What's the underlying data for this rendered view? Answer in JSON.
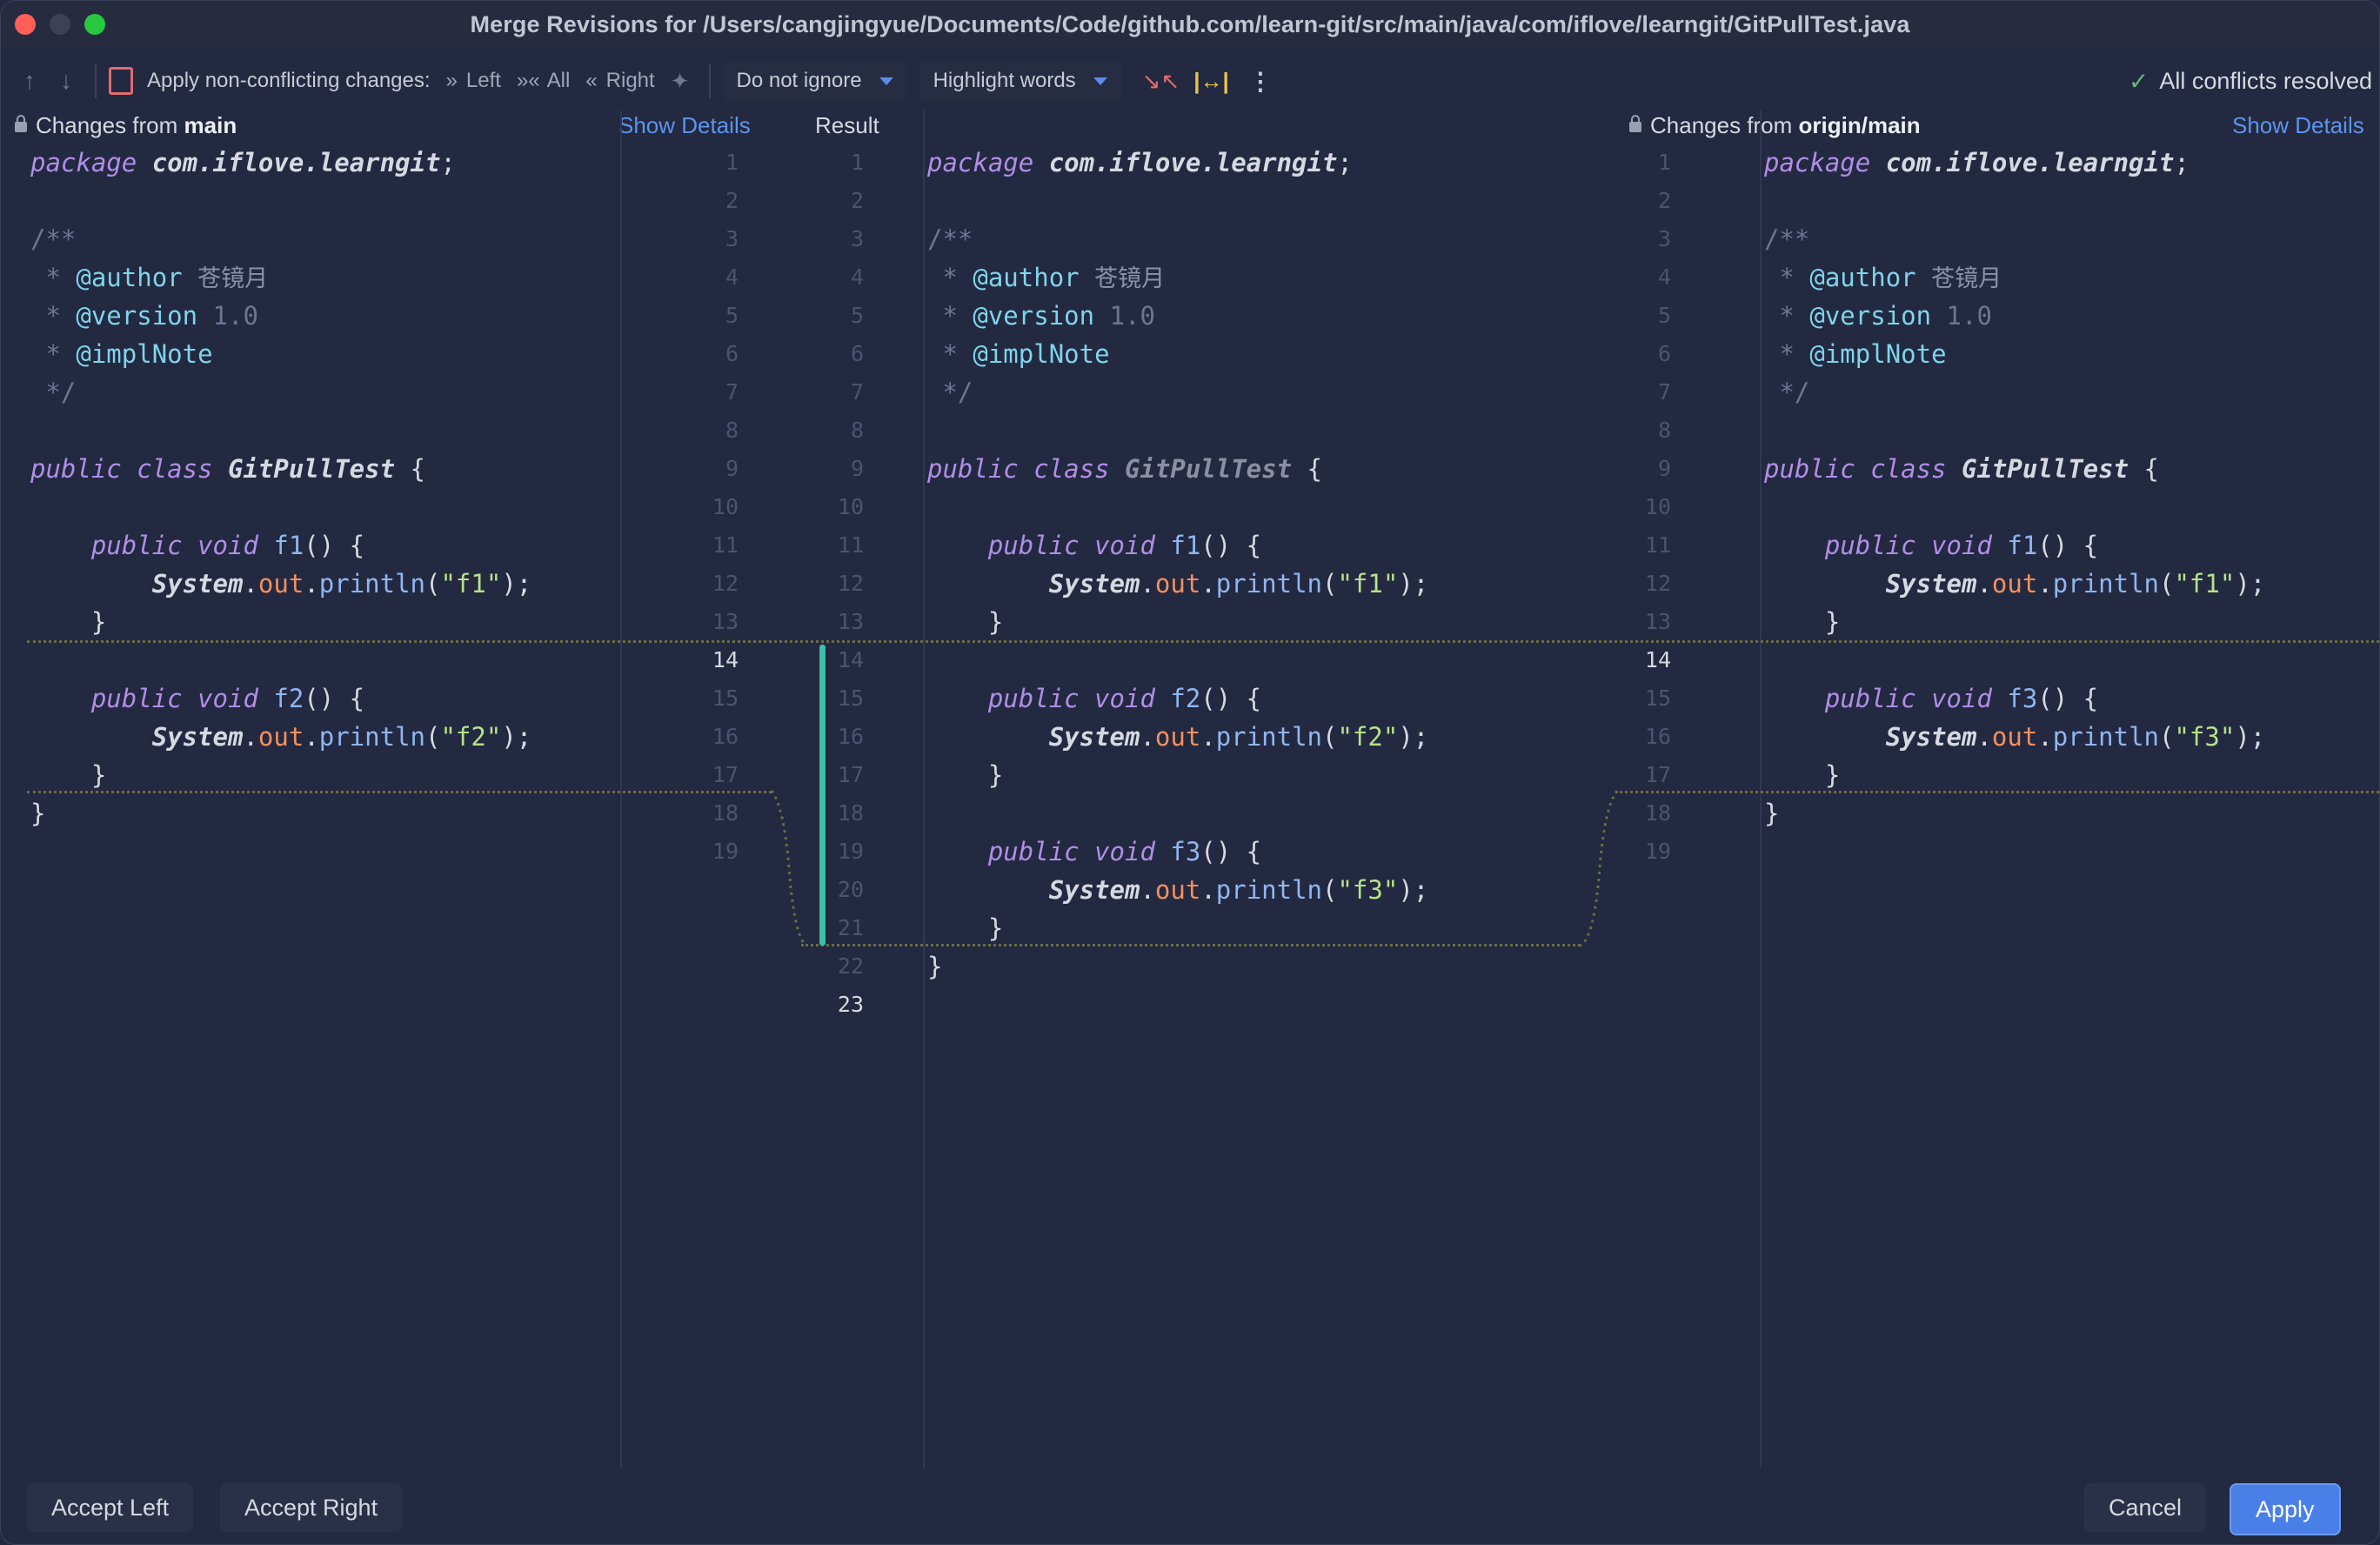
{
  "window": {
    "title": "Merge Revisions for /Users/cangjingyue/Documents/Code/github.com/learn-git/src/main/java/com/iflove/learngit/GitPullTest.java"
  },
  "toolbar": {
    "apply_label": "Apply non-conflicting changes:",
    "left": "Left",
    "all": "All",
    "right": "Right",
    "ignore_dropdown": "Do not ignore",
    "highlight_dropdown": "Highlight words",
    "status": "All conflicts resolved"
  },
  "left_header": {
    "prefix": "Changes from ",
    "branch": "main",
    "details": "Show Details"
  },
  "center_header": {
    "label": "Result"
  },
  "right_header": {
    "prefix": "Changes from ",
    "branch": "origin/main",
    "details": "Show Details"
  },
  "colors": {
    "accent": "#4a7fe8",
    "resolved": "#5fb87a",
    "merge_bar": "#3dbfa8"
  },
  "left_pane": {
    "line_numbers": [
      "1",
      "2",
      "3",
      "4",
      "5",
      "6",
      "7",
      "8",
      "9",
      "10",
      "11",
      "12",
      "13",
      "14",
      "15",
      "16",
      "17",
      "18",
      "19"
    ],
    "lines": [
      "package com.iflove.learngit;",
      "",
      "/**",
      " * @author 苍镜月",
      " * @version 1.0",
      " * @implNote",
      " */",
      "",
      "public class GitPullTest {",
      "",
      "    public void f1() {",
      "        System.out.println(\"f1\");",
      "    }",
      "",
      "    public void f2() {",
      "        System.out.println(\"f2\");",
      "    }",
      "}",
      ""
    ]
  },
  "center_pane": {
    "line_numbers": [
      "1",
      "2",
      "3",
      "4",
      "5",
      "6",
      "7",
      "8",
      "9",
      "10",
      "11",
      "12",
      "13",
      "14",
      "15",
      "16",
      "17",
      "18",
      "19",
      "20",
      "21",
      "22",
      "23"
    ],
    "lines": [
      "package com.iflove.learngit;",
      "",
      "/**",
      " * @author 苍镜月",
      " * @version 1.0",
      " * @implNote",
      " */",
      "",
      "public class GitPullTest {",
      "",
      "    public void f1() {",
      "        System.out.println(\"f1\");",
      "    }",
      "",
      "    public void f2() {",
      "        System.out.println(\"f2\");",
      "    }",
      "",
      "    public void f3() {",
      "        System.out.println(\"f3\");",
      "    }",
      "}",
      ""
    ]
  },
  "right_pane": {
    "line_numbers": [
      "1",
      "2",
      "3",
      "4",
      "5",
      "6",
      "7",
      "8",
      "9",
      "10",
      "11",
      "12",
      "13",
      "14",
      "15",
      "16",
      "17",
      "18",
      "19"
    ],
    "lines": [
      "package com.iflove.learngit;",
      "",
      "/**",
      " * @author 苍镜月",
      " * @version 1.0",
      " * @implNote",
      " */",
      "",
      "public class GitPullTest {",
      "",
      "    public void f1() {",
      "        System.out.println(\"f1\");",
      "    }",
      "",
      "    public void f3() {",
      "        System.out.println(\"f3\");",
      "    }",
      "}",
      ""
    ]
  },
  "buttons": {
    "accept_left": "Accept Left",
    "accept_right": "Accept Right",
    "cancel": "Cancel",
    "apply": "Apply"
  },
  "icons": [
    "arrow-up-icon",
    "arrow-down-icon",
    "compare-icon",
    "double-chevron-right-icon",
    "double-chevron-left-icon",
    "magic-wand-icon",
    "collapse-icon",
    "sync-scroll-icon",
    "more-vert-icon",
    "check-icon",
    "lock-icon"
  ]
}
